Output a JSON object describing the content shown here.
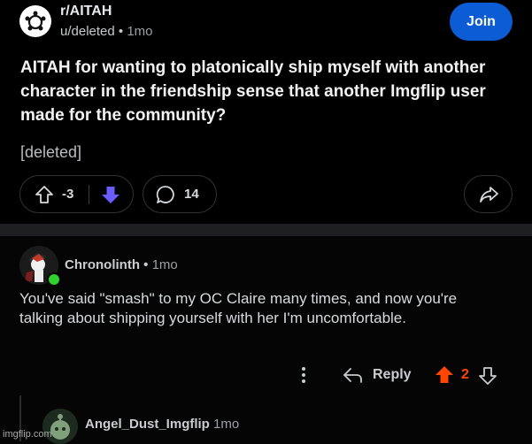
{
  "post": {
    "subreddit": "r/AITAH",
    "author": "u/deleted",
    "separator": "•",
    "time": "1mo",
    "join_label": "Join",
    "title": "AITAH for wanting to platonically ship myself with another character in the friendship sense that another Imgflip user made for the community?",
    "body": "[deleted]",
    "vote_count": "-3",
    "comment_count": "14",
    "icons": {
      "subreddit": "snoo-icon",
      "upvote": "upvote-outline-icon",
      "downvote": "downvote-filled-icon",
      "comment": "comment-bubble-icon",
      "share": "share-icon"
    }
  },
  "comment": {
    "author": "Chronolinth",
    "separator": "•",
    "time": "1mo",
    "text": "You've said \"smash\" to my OC Claire many times, and now you're talking about shipping yourself with her I'm uncomfortable.",
    "reply_label": "Reply",
    "score": "2",
    "icons": {
      "more": "more-vertical-icon",
      "reply": "reply-arrow-icon",
      "upvote": "upvote-filled-icon",
      "downvote": "downvote-outline-icon"
    }
  },
  "reply": {
    "author": "Angel_Dust_Imgflip",
    "time": "1mo"
  },
  "watermark": "imgflip.com",
  "colors": {
    "join": "#0b5cd5",
    "downvote_active": "#6a5cff",
    "upvote_active": "#ff4500",
    "online": "#2ed12e"
  }
}
